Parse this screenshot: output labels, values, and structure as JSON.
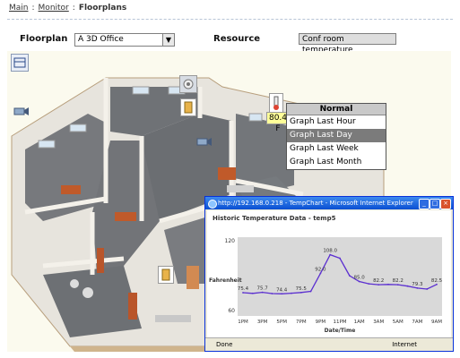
{
  "breadcrumb": {
    "main": "Main",
    "sep": ":",
    "monitor": "Monitor",
    "current": "Floorplans"
  },
  "form": {
    "floorplan_label": "Floorplan",
    "floorplan_value": "A 3D Office",
    "resource_label": "Resource",
    "resource_value": "Conf room temperature"
  },
  "sensor": {
    "temperature_badge": "80.4 F"
  },
  "graph_menu": {
    "header": "Normal",
    "items": [
      "Graph Last Hour",
      "Graph Last Day",
      "Graph Last Week",
      "Graph Last Month"
    ],
    "selected_index": 1
  },
  "ie_window": {
    "title": "http://192.168.0.218 - TempChart - Microsoft Internet Explorer",
    "status_left": "Done",
    "status_right": "Internet"
  },
  "chart_data": {
    "type": "line",
    "title": "Historic Temperature Data - temp5",
    "xlabel": "Date/Time",
    "ylabel": "Fahrenheit",
    "ylim": [
      60,
      120
    ],
    "ytick_labels": [
      "120",
      "60"
    ],
    "xtick_labels": [
      "1PM",
      "3PM",
      "5PM",
      "7PM",
      "9PM",
      "11PM",
      "1AM",
      "3AM",
      "5AM",
      "7AM",
      "9AM"
    ],
    "series": [
      {
        "color": "#5b2fd0",
        "x": [
          "1PM",
          "2PM",
          "3PM",
          "4PM",
          "5PM",
          "6PM",
          "7PM",
          "8PM",
          "9PM",
          "10PM",
          "11PM",
          "12AM",
          "1AM",
          "2AM",
          "3AM",
          "4AM",
          "5AM",
          "6AM",
          "7AM",
          "8AM",
          "9AM"
        ],
        "values": [
          75.4,
          74.8,
          75.7,
          74.6,
          74.4,
          74.9,
          75.5,
          76.5,
          92.0,
          108.0,
          105.0,
          90.0,
          85.0,
          83.0,
          82.2,
          82.5,
          82.2,
          81.0,
          79.3,
          78.5,
          82.5
        ],
        "labels": [
          "75.4",
          "",
          "75.7",
          "",
          "74.4",
          "",
          "75.5",
          "",
          "92.0",
          "108.0",
          "",
          "",
          "85.0",
          "",
          "82.2",
          "",
          "82.2",
          "",
          "79.3",
          "",
          "82.5"
        ]
      }
    ],
    "grid": false
  }
}
